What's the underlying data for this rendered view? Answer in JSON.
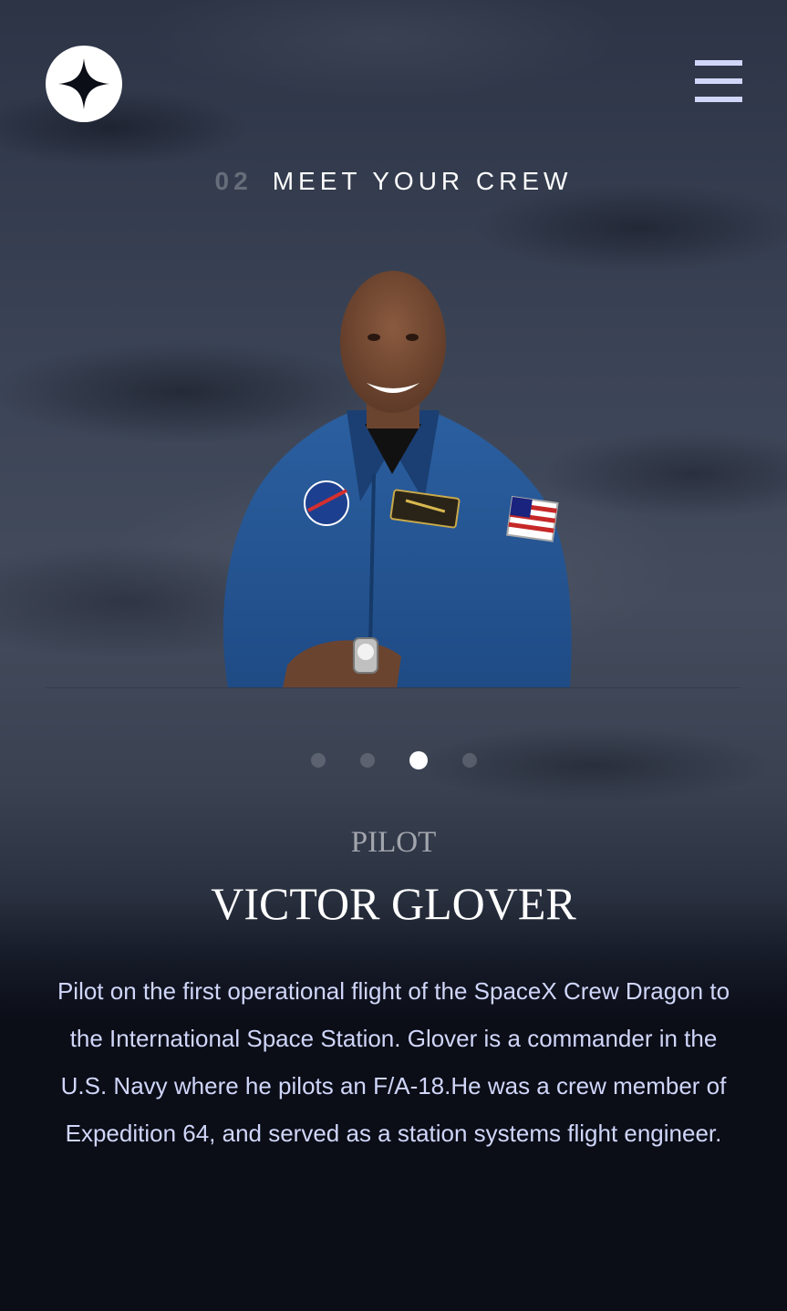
{
  "header": {
    "logo_icon": "star-logo-icon",
    "menu_icon": "hamburger-menu-icon"
  },
  "page_heading": {
    "number": "02",
    "title": "MEET YOUR CREW"
  },
  "crew": {
    "dots_count": 4,
    "active_index": 2,
    "member": {
      "role": "PILOT",
      "name": "VICTOR GLOVER",
      "bio": "Pilot on the first operational flight of the SpaceX Crew Dragon to the International Space Station. Glover is a commander in the U.S. Navy where he pilots an F/A-18.He was a crew member of Expedition 64, and served as a station systems flight engineer."
    }
  },
  "colors": {
    "background": "#0b0d17",
    "accent": "#d0d6f9",
    "text": "#ffffff"
  }
}
